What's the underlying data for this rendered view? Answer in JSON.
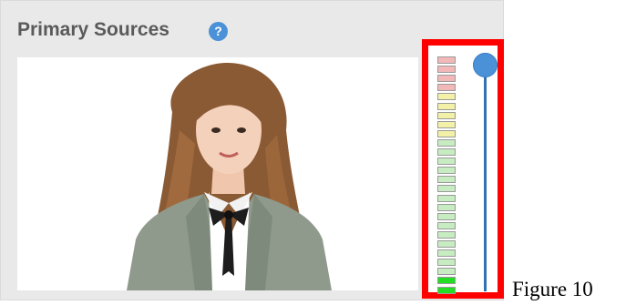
{
  "panel": {
    "title": "Primary Sources",
    "help_icon": "question-mark-icon",
    "help_glyph": "?"
  },
  "preview": {
    "content": "presenter-video-thumbnail"
  },
  "level_meter": {
    "segments_top_to_bottom": [
      "#f2b8b8",
      "#f2b8b8",
      "#f2b8b8",
      "#f2b8b8",
      "#f3f0a8",
      "#f3f0a8",
      "#f3f0a8",
      "#f3f0a8",
      "#f3f0a8",
      "#c8ecc2",
      "#c8ecc2",
      "#c8ecc2",
      "#c8ecc2",
      "#c8ecc2",
      "#c8ecc2",
      "#c8ecc2",
      "#c8ecc2",
      "#c8ecc2",
      "#c8ecc2",
      "#c8ecc2",
      "#c8ecc2",
      "#c8ecc2",
      "#c8ecc2",
      "#c8ecc2",
      "#22dd22",
      "#22dd22"
    ],
    "colors": {
      "clip": "#f2b8b8",
      "warn": "#f3f0a8",
      "ok": "#c8ecc2",
      "active": "#22dd22"
    },
    "highlight_color": "#ff0000"
  },
  "volume_slider": {
    "level": 1.0,
    "track_color": "#2f73b4",
    "handle_color": "#4b91d8"
  },
  "caption": "Figure 10"
}
